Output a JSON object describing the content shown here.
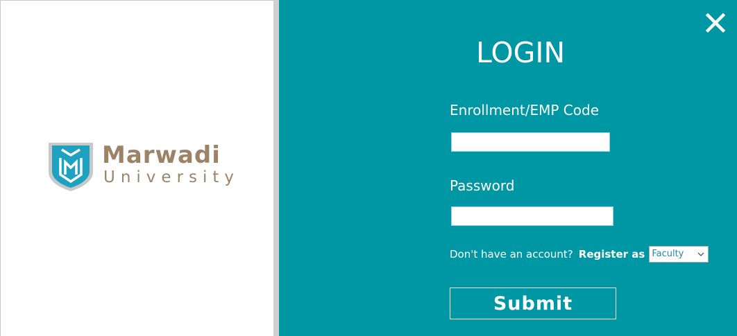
{
  "branding": {
    "name": "Marwadi",
    "sub": "University",
    "logo_icon": "marwadi-shield-logo",
    "text_color": "#9c8367",
    "shield_color": "#1ea2c0"
  },
  "login": {
    "title": "LOGIN",
    "close_icon": "close-icon",
    "enrollment_label": "Enrollment/EMP Code",
    "enrollment_value": "",
    "password_label": "Password",
    "password_value": "",
    "register_prompt": "Don't have an account?",
    "register_label": "Register as",
    "register_role": "Faculty",
    "submit_label": "Submit",
    "accent_color": "#0097a4"
  }
}
